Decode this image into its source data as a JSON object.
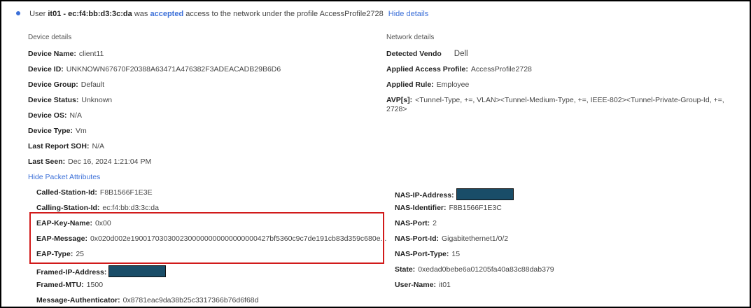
{
  "header": {
    "prefix": "User",
    "user": "it01 - ec:f4:bb:d3:3c:da",
    "was": "was",
    "status": "accepted",
    "rest": "access to the network under the profile AccessProfile2728",
    "hide_details": "Hide details"
  },
  "device": {
    "title": "Device details",
    "rows": [
      {
        "label": "Device Name:",
        "value": "client11"
      },
      {
        "label": "Device ID:",
        "value": "UNKNOWN67670F20388A63471A476382F3ADEACADB29B6D6"
      },
      {
        "label": "Device Group:",
        "value": "Default"
      },
      {
        "label": "Device Status:",
        "value": "Unknown"
      },
      {
        "label": "Device OS:",
        "value": "N/A"
      },
      {
        "label": "Device Type:",
        "value": "Vm"
      },
      {
        "label": "Last Report SOH:",
        "value": "N/A"
      },
      {
        "label": "Last Seen:",
        "value": "Dec 16, 2024 1:21:04 PM"
      }
    ]
  },
  "network": {
    "title": "Network details",
    "rows": [
      {
        "label": "Detected Vendo",
        "value": "Dell"
      },
      {
        "label": "Applied Access Profile:",
        "value": "AccessProfile2728"
      },
      {
        "label": "Applied Rule:",
        "value": "Employee"
      },
      {
        "label": "AVP[s]:",
        "value": "<Tunnel-Type, +=, VLAN><Tunnel-Medium-Type, +=, IEEE-802><Tunnel-Private-Group-Id, +=, 2728>"
      }
    ]
  },
  "hide_packet": "Hide Packet Attributes",
  "packet_left": [
    {
      "label": "Called-Station-Id:",
      "value": "F8B1566F1E3E"
    },
    {
      "label": "Calling-Station-Id:",
      "value": "ec:f4:bb:d3:3c:da"
    },
    {
      "label": "EAP-Key-Name:",
      "value": "0x00"
    },
    {
      "label": "EAP-Message:",
      "value": "0x020d002e1900170303002300000000000000000427bf5360c9c7de191cb83d359c680e..."
    },
    {
      "label": "EAP-Type:",
      "value": "25"
    },
    {
      "label": "Framed-IP-Address:",
      "value": ""
    },
    {
      "label": "Framed-MTU:",
      "value": "1500"
    },
    {
      "label": "Message-Authenticator:",
      "value": "0x8781eac9da38b25c3317366b76d6f68d"
    }
  ],
  "packet_right": [
    {
      "label": "NAS-IP-Address:",
      "value": ""
    },
    {
      "label": "NAS-Identifier:",
      "value": "F8B1566F1E3C"
    },
    {
      "label": "NAS-Port:",
      "value": "2"
    },
    {
      "label": "NAS-Port-Id:",
      "value": "Gigabitethernet1/0/2"
    },
    {
      "label": "NAS-Port-Type:",
      "value": "15"
    },
    {
      "label": "State:",
      "value": "0xedad0bebe6a01205fa40a83c88dab379"
    },
    {
      "label": "User-Name:",
      "value": "it01"
    }
  ]
}
